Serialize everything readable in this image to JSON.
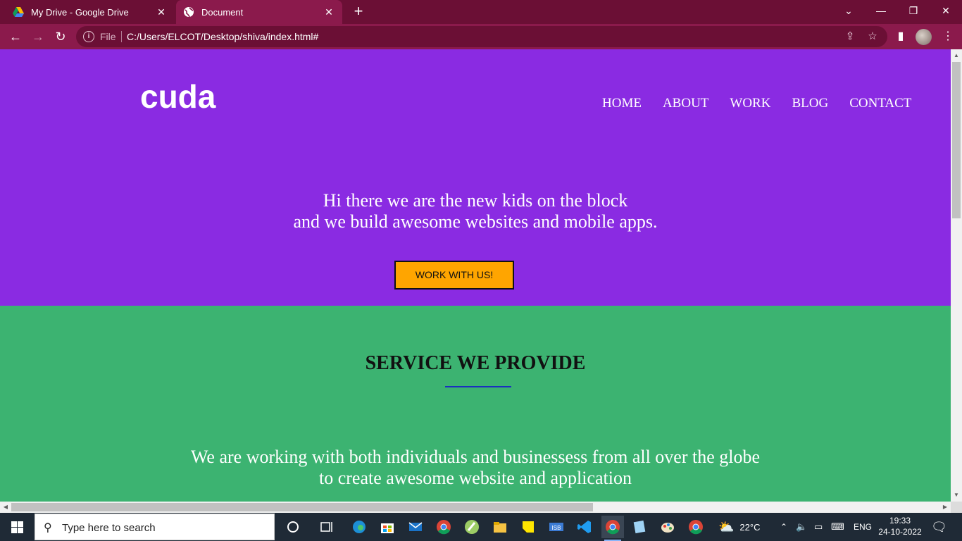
{
  "browser": {
    "tabs": [
      {
        "title": "My Drive - Google Drive",
        "active": false
      },
      {
        "title": "Document",
        "active": true
      }
    ],
    "address": {
      "scheme_label": "File",
      "url": "C:/Users/ELCOT/Desktop/shiva/index.html#"
    },
    "theme_color": "#8b1a4c"
  },
  "page": {
    "logo": "cuda",
    "nav": [
      "HOME",
      "ABOUT",
      "WORK",
      "BLOG",
      "CONTACT"
    ],
    "hero": {
      "line1": "Hi there we are the new kids on the block",
      "line2": "and we build awesome websites and mobile apps.",
      "cta": "WORK WITH US!",
      "background": "#8a2be2",
      "cta_color": "#ffa500"
    },
    "services": {
      "title": "SERVICE WE PROVIDE",
      "line1": "We are working with both individuals and businessess from all over the globe",
      "line2": "to create awesome website and application",
      "background": "#3cb371"
    }
  },
  "taskbar": {
    "search_placeholder": "Type here to search",
    "weather": "22°C",
    "language": "ENG",
    "time": "19:33",
    "date": "24-10-2022",
    "apps": [
      "task-view",
      "edge",
      "microsoft-store",
      "mail",
      "chrome",
      "android-studio",
      "file-explorer",
      "sticky-notes",
      "isb-app",
      "vs-code",
      "chrome-profile",
      "notepad-plus",
      "paint",
      "chrome-profile-2"
    ]
  }
}
